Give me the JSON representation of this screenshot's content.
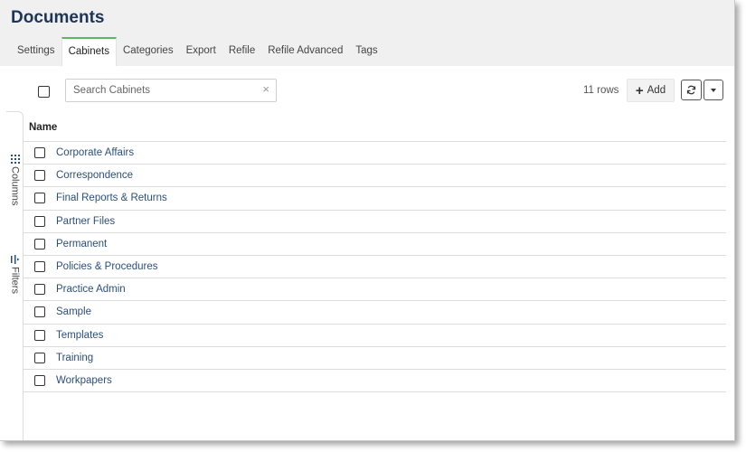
{
  "header": {
    "title": "Documents",
    "tabs": [
      {
        "label": "Settings",
        "active": false
      },
      {
        "label": "Cabinets",
        "active": true
      },
      {
        "label": "Categories",
        "active": false
      },
      {
        "label": "Export",
        "active": false
      },
      {
        "label": "Refile",
        "active": false
      },
      {
        "label": "Refile Advanced",
        "active": false
      },
      {
        "label": "Tags",
        "active": false
      }
    ],
    "accent_color": "#5cb85c"
  },
  "toolbar": {
    "search": {
      "placeholder": "Search Cabinets",
      "value": ""
    },
    "clear_symbol": "×",
    "rows_count": "11 rows",
    "add_label": "Add",
    "add_symbol": "+"
  },
  "side_panel": {
    "columns_label": "Columns",
    "filters_label": "Filters"
  },
  "table": {
    "column_header": "Name",
    "rows": [
      "Corporate Affairs",
      "Correspondence",
      "Final Reports & Returns",
      "Partner Files",
      "Permanent",
      "Policies & Procedures",
      "Practice Admin",
      "Sample",
      "Templates",
      "Training",
      "Workpapers"
    ]
  }
}
